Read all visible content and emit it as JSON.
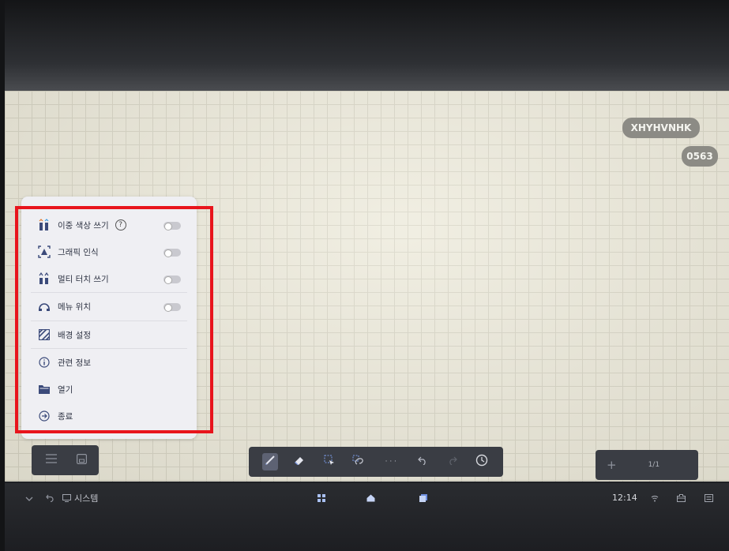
{
  "board": {
    "id_badge": "XHYHVNHK",
    "code_badge": "0563"
  },
  "menu": {
    "items": [
      {
        "label": "이중 색상 쓰기",
        "icon": "dual-color-pen-icon",
        "has_toggle": true,
        "toggle_on": false,
        "has_help": true
      },
      {
        "label": "그래픽 인식",
        "icon": "shape-recognition-icon",
        "has_toggle": true,
        "toggle_on": false
      },
      {
        "label": "멀티 터치 쓰기",
        "icon": "multi-touch-pen-icon",
        "has_toggle": true,
        "toggle_on": false
      },
      {
        "label": "메뉴 위치",
        "icon": "menu-position-icon",
        "has_toggle": true,
        "toggle_on": false
      },
      {
        "label": "배경 설정",
        "icon": "background-pattern-icon"
      },
      {
        "label": "관련 정보",
        "icon": "info-icon"
      },
      {
        "label": "열기",
        "icon": "folder-icon"
      },
      {
        "label": "종료",
        "icon": "exit-icon"
      }
    ],
    "help_glyph": "?"
  },
  "bottom_left": {
    "icons": [
      "menu-icon",
      "save-icon"
    ]
  },
  "toolbar": {
    "icons": [
      "pen-icon",
      "eraser-icon",
      "select-icon",
      "lasso-icon",
      "more-icon",
      "undo-icon",
      "redo-icon",
      "clock-icon"
    ],
    "more_glyph": "· · ·"
  },
  "page": {
    "add_glyph": "+",
    "indicator": "1/1"
  },
  "taskbar": {
    "system_label": "시스템",
    "time": "12:14",
    "icons": [
      "chevron-down-icon",
      "back-icon",
      "system-icon",
      "apps-icon",
      "home-icon",
      "recent-apps-icon",
      "wifi-icon",
      "toolbox-icon",
      "keyboard-icon"
    ]
  },
  "colors": {
    "highlight_frame": "#e8141c",
    "canvas": "#ece9d9",
    "accent": "#3b4a7a"
  }
}
